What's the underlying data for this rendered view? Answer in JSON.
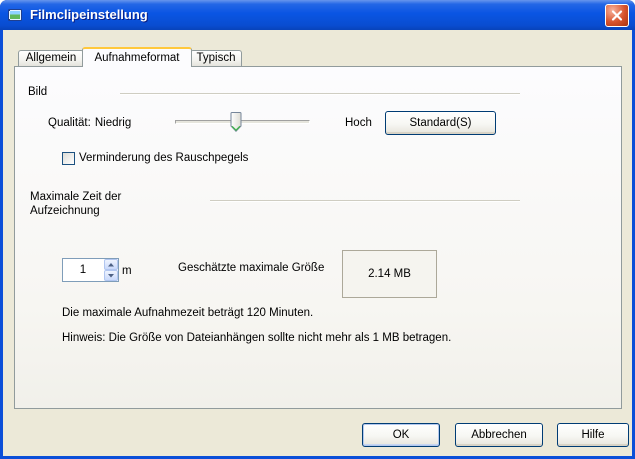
{
  "window": {
    "title": "Filmclipeinstellung"
  },
  "tabs": [
    {
      "label": "Allgemein",
      "active": false
    },
    {
      "label": "Aufnahmeformat",
      "active": true
    },
    {
      "label": "Typisch",
      "active": false
    }
  ],
  "picture": {
    "group_title": "Bild",
    "quality_label": "Qualität:",
    "quality_low_label": "Niedrig",
    "quality_high_label": "Hoch",
    "quality_level": 0.45,
    "default_button_label": "Standard(S)",
    "noise_reduction_label": "Verminderung des Rauschpegels",
    "noise_reduction_checked": false
  },
  "recording": {
    "group_title_line1": "Maximale Zeit der",
    "group_title_line2": "Aufzeichnung",
    "duration_value": "1",
    "duration_unit": "m",
    "estimated_size_label": "Geschätzte maximale Größe",
    "estimated_size_value": "2.14 MB",
    "max_time_note": "Die maximale Aufnahmezeit beträgt 120 Minuten.",
    "attachment_hint": "Hinweis: Die Größe von Dateianhängen sollte nicht mehr als 1 MB betragen."
  },
  "buttons": {
    "ok_label": "OK",
    "cancel_label": "Abbrechen",
    "help_label": "Hilfe"
  },
  "icons": {
    "app": "film-clip-icon",
    "close": "close-icon",
    "spin_up": "arrow-up-icon",
    "spin_down": "arrow-down-icon",
    "checkbox_mark": "check-icon"
  },
  "colors": {
    "title_bar": "#0A55E3",
    "window_frame": "#0B4FD8",
    "window_background": "#ECE9D8",
    "close_button": "#D8532C",
    "active_tab_highlight": "#FFC83C",
    "button_border": "#003C74"
  }
}
